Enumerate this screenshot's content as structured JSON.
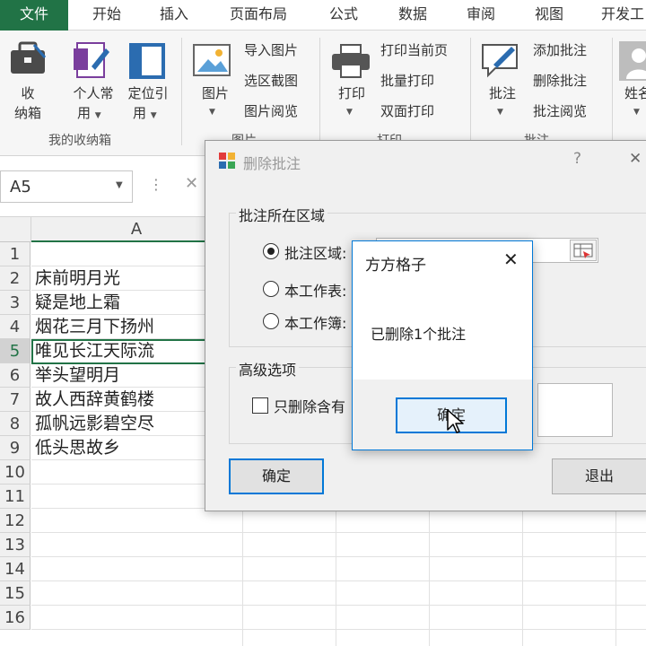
{
  "ribbon_tabs": [
    "文件",
    "开始",
    "插入",
    "页面布局",
    "公式",
    "数据",
    "审阅",
    "视图",
    "开发工"
  ],
  "ribbon": {
    "storage_box": {
      "line1": "收",
      "line2": "纳箱"
    },
    "personal": {
      "line1": "个人常",
      "line2": "用"
    },
    "locate_ref": {
      "line1": "定位引",
      "line2": "用"
    },
    "group_mybox": "我的收纳箱",
    "picture": "图片",
    "import_picture": "导入图片",
    "region_screenshot": "选区截图",
    "picture_browse": "图片阅览",
    "group_picture": "图片",
    "print": "打印",
    "print_current": "打印当前页",
    "batch_print": "批量打印",
    "duplex_print": "双面打印",
    "group_print": "打印",
    "comment": "批注",
    "add_comment": "添加批注",
    "delete_comment": "删除批注",
    "comment_browse": "批注阅览",
    "group_comment": "批注",
    "name": "姓名"
  },
  "formula_bar": {
    "name_box": "A5",
    "fx_separator": "⋮",
    "cancel_symbol": "✕"
  },
  "sheet": {
    "column_header": "A",
    "rows": [
      {
        "num": "1",
        "value": ""
      },
      {
        "num": "2",
        "value": "床前明月光"
      },
      {
        "num": "3",
        "value": "疑是地上霜"
      },
      {
        "num": "4",
        "value": "烟花三月下扬州"
      },
      {
        "num": "5",
        "value": "唯见长江天际流"
      },
      {
        "num": "6",
        "value": "举头望明月"
      },
      {
        "num": "7",
        "value": "故人西辞黄鹤楼"
      },
      {
        "num": "8",
        "value": "孤帆远影碧空尽"
      },
      {
        "num": "9",
        "value": "低头思故乡"
      },
      {
        "num": "10",
        "value": ""
      },
      {
        "num": "11",
        "value": ""
      },
      {
        "num": "12",
        "value": ""
      },
      {
        "num": "13",
        "value": ""
      },
      {
        "num": "14",
        "value": ""
      },
      {
        "num": "15",
        "value": ""
      },
      {
        "num": "16",
        "value": ""
      }
    ]
  },
  "delete_dialog": {
    "title": "删除批注",
    "help": "?",
    "close": "✕",
    "area_group": "批注所在区域",
    "option_area": "批注区域:",
    "option_sheet": "本工作表:",
    "option_book": "本工作簿:",
    "advanced_group": "高级选项",
    "only_delete": "只删除含有",
    "ok": "确定",
    "exit": "退出"
  },
  "message_box": {
    "title": "方方格子",
    "close": "✕",
    "message": "已删除1个批注",
    "ok": "确定"
  },
  "colors": {
    "excel_green": "#217346",
    "accent_blue": "#0078d7"
  }
}
